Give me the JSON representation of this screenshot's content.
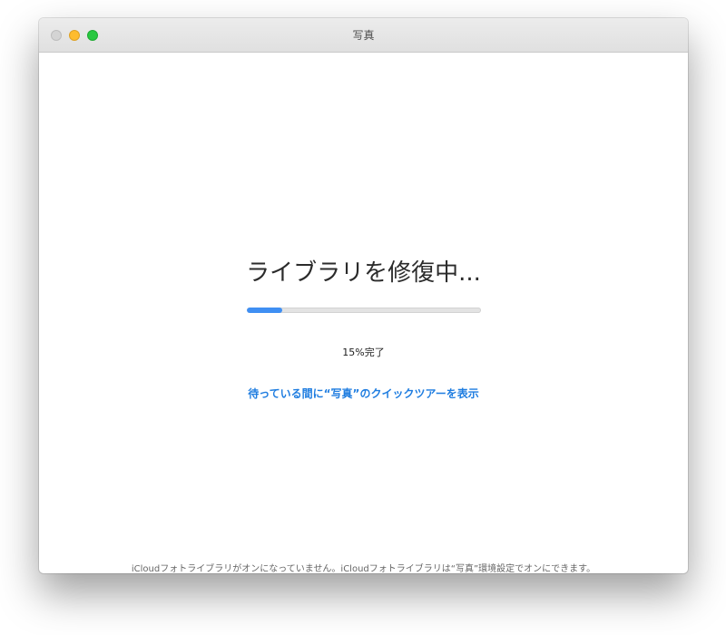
{
  "window": {
    "title": "写真"
  },
  "main": {
    "heading": "ライブラリを修復中...",
    "progress": {
      "fraction": 0.15,
      "label": "15%完了"
    },
    "tour_link": "待っている間に“写真”のクイックツアーを表示",
    "footer_note": "iCloudフォトライブラリがオンになっていません。iCloudフォトライブラリは“写真”環境設定でオンにできます。"
  },
  "colors": {
    "accent": "#3f8ff3",
    "link": "#1f7de0",
    "traffic_close": "#d4d4d4",
    "traffic_minimize": "#febc2e",
    "traffic_zoom": "#28c840"
  }
}
